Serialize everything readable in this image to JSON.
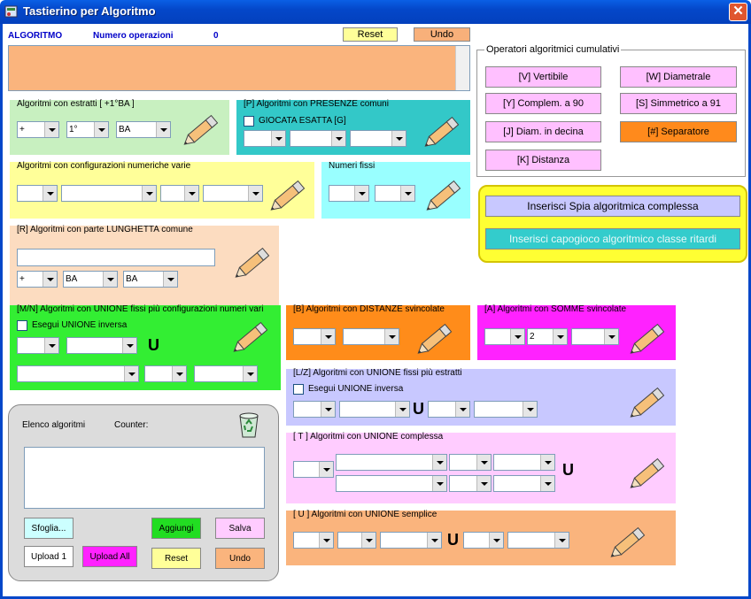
{
  "window": {
    "title": "Tastierino per Algoritmo",
    "close_glyph": "✕"
  },
  "header": {
    "algoritmo_label": "ALGORITMO",
    "num_op_label": "Numero operazioni",
    "num_op_value": "0",
    "reset_label": "Reset",
    "undo_label": "Undo"
  },
  "ops_group": {
    "caption": "Operatori algoritmici cumulativi",
    "buttons": [
      "[V] Vertibile",
      "[W] Diametrale",
      "[Y] Complem. a 90",
      "[S] Simmetrico  a 91",
      "[J] Diam. in decina",
      "[#] Separatore",
      "[K] Distanza"
    ]
  },
  "spia": {
    "insert_spia": "Inserisci Spia algoritmica complessa",
    "insert_capogioco": "Inserisci capogioco algoritmico classe ritardi"
  },
  "estratti": {
    "caption": "Algoritmi con estratti  [ +1°BA ]",
    "c1": "+",
    "c2": "1°",
    "c3": "BA"
  },
  "presenze": {
    "caption": "[P] Algoritmi con PRESENZE comuni",
    "check": "GIOCATA ESATTA  [G]"
  },
  "config": {
    "caption": "Algoritmi con configurazioni numeriche varie"
  },
  "fissi": {
    "caption": "Numeri fissi"
  },
  "lunghetta": {
    "caption": "[R] Algoritmi con parte LUNGHETTA comune",
    "c1": "+",
    "c2": "BA",
    "c3": "BA"
  },
  "mn": {
    "caption": "[M/N] Algoritmi con UNIONE fissi più configurazioni numeri vari",
    "check": "Esegui UNIONE inversa",
    "u": "U"
  },
  "distanze": {
    "caption": "[B] Algoritmi con DISTANZE svincolate"
  },
  "somme": {
    "caption": "[A] Algoritmi con SOMME svincolate",
    "c2": "2"
  },
  "lz": {
    "caption": "[L/Z] Algoritmi con UNIONE fissi più estratti",
    "check": "Esegui UNIONE inversa",
    "u": "U"
  },
  "complessa": {
    "caption": "[ T ] Algoritmi con UNIONE complessa",
    "u": "U"
  },
  "semplice": {
    "caption": "[ U ] Algoritmi con UNIONE semplice",
    "u": "U"
  },
  "elenco": {
    "title": "Elenco algoritmi",
    "counter": "Counter:",
    "sfoglia": "Sfoglia...",
    "aggiungi": "Aggiungi",
    "salva": "Salva",
    "upload1": "Upload 1",
    "uploadall": "Upload All",
    "reset": "Reset",
    "undo": "Undo"
  },
  "icons": [
    "app-icon",
    "close-icon",
    "pencil-icon",
    "recycle-bin-icon"
  ]
}
